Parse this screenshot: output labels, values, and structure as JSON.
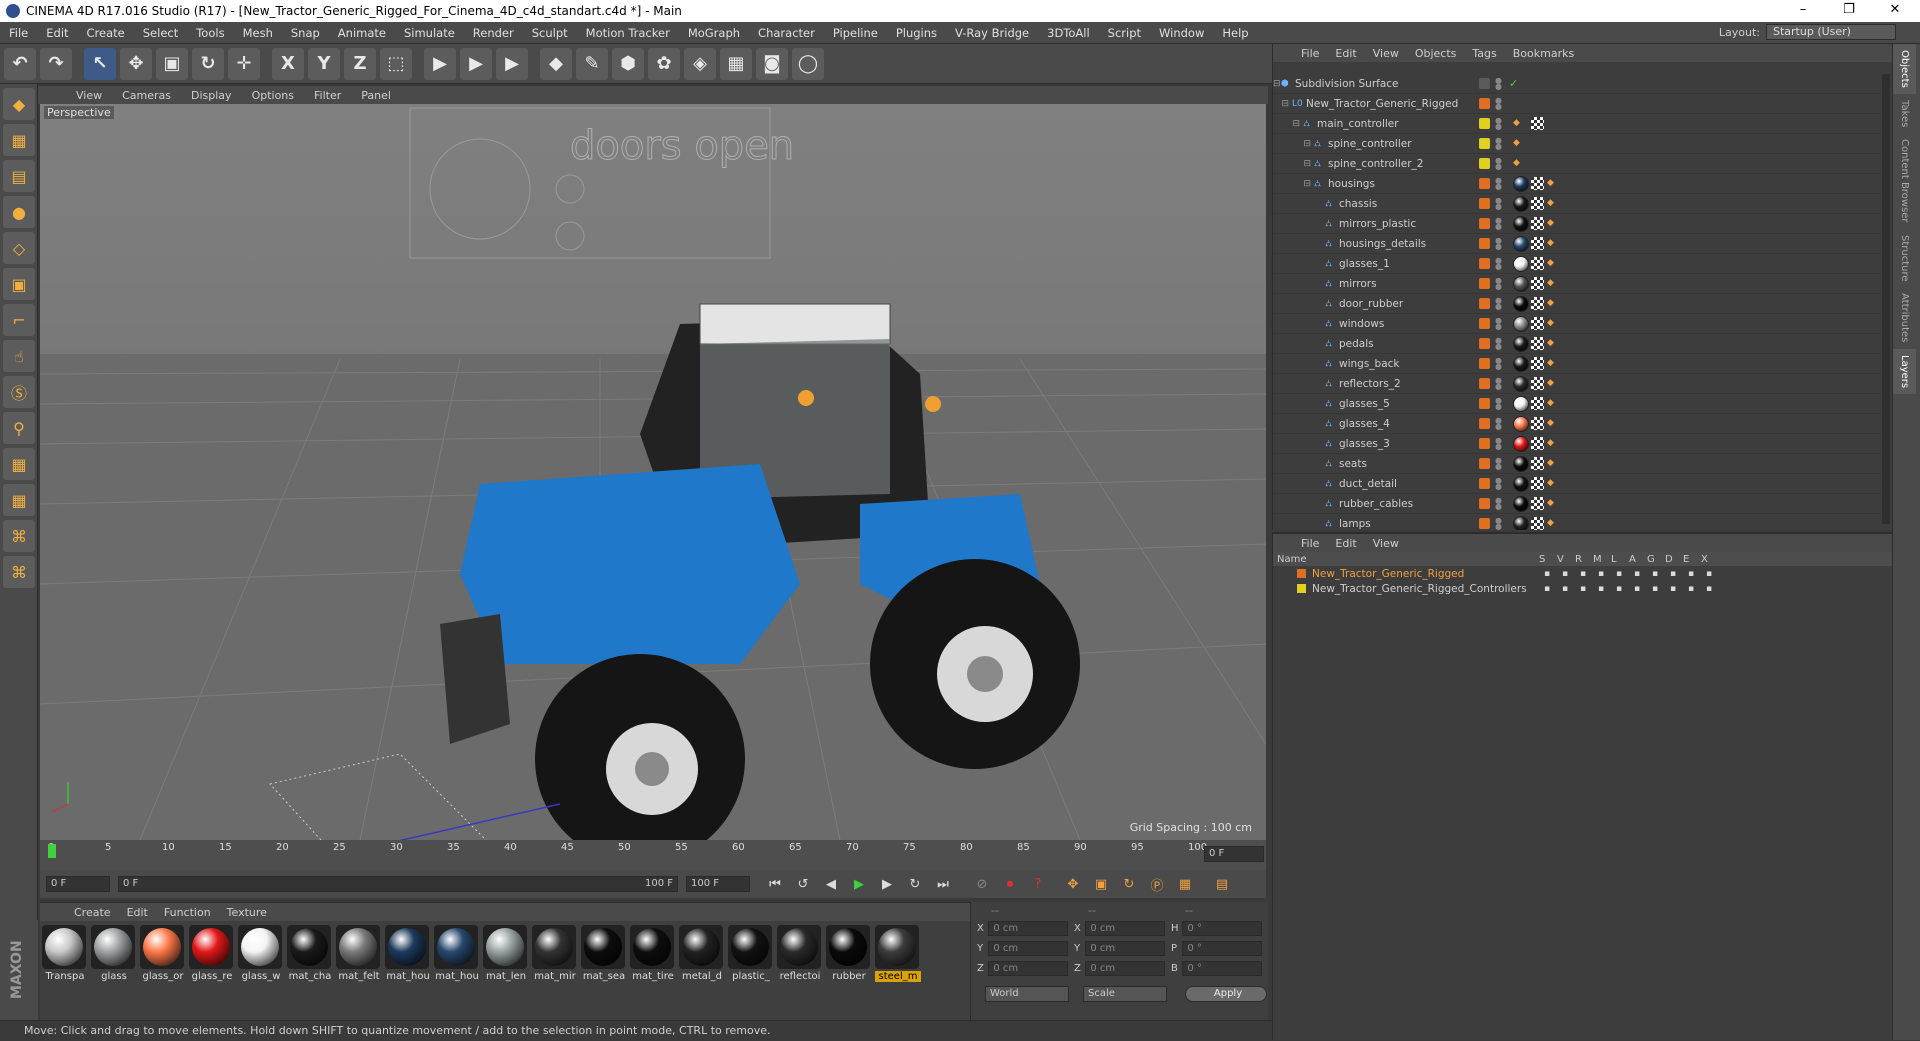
{
  "window": {
    "title": "CINEMA 4D R17.016 Studio (R17) - [New_Tractor_Generic_Rigged_For_Cinema_4D_c4d_standart.c4d *] - Main",
    "minimize": "–",
    "maximize": "❐",
    "close": "✕"
  },
  "menu": [
    "File",
    "Edit",
    "Create",
    "Select",
    "Tools",
    "Mesh",
    "Snap",
    "Animate",
    "Simulate",
    "Render",
    "Sculpt",
    "Motion Tracker",
    "MoGraph",
    "Character",
    "Pipeline",
    "Plugins",
    "V-Ray Bridge",
    "3DToAll",
    "Script",
    "Window",
    "Help"
  ],
  "layout": {
    "label": "Layout:",
    "value": "Startup (User)"
  },
  "toolbar": [
    {
      "name": "undo-button",
      "glyph": "↶"
    },
    {
      "name": "redo-button",
      "glyph": "↷"
    },
    {
      "name": "select-tool-button",
      "glyph": "↖",
      "active": true
    },
    {
      "name": "move-tool-button",
      "glyph": "✥"
    },
    {
      "name": "scale-tool-button",
      "glyph": "▣"
    },
    {
      "name": "rotate-tool-button",
      "glyph": "↻"
    },
    {
      "name": "create-tool-button",
      "glyph": "✛"
    },
    {
      "name": "x-axis-button",
      "glyph": "X"
    },
    {
      "name": "y-axis-button",
      "glyph": "Y"
    },
    {
      "name": "z-axis-button",
      "glyph": "Z"
    },
    {
      "name": "coordinate-system-button",
      "glyph": "⬚"
    },
    {
      "name": "render-view-button",
      "glyph": "▶"
    },
    {
      "name": "render-picture-viewer-button",
      "glyph": "▶"
    },
    {
      "name": "render-settings-button",
      "glyph": "▶"
    },
    {
      "name": "cube-object-button",
      "glyph": "◆"
    },
    {
      "name": "spline-pen-button",
      "glyph": "✎"
    },
    {
      "name": "subdivision-surface-button",
      "glyph": "⬢"
    },
    {
      "name": "mograph-cloner-button",
      "glyph": "✿"
    },
    {
      "name": "deformer-button",
      "glyph": "◈"
    },
    {
      "name": "floor-object-button",
      "glyph": "▦"
    },
    {
      "name": "camera-object-button",
      "glyph": "◙"
    },
    {
      "name": "light-object-button",
      "glyph": "◯"
    }
  ],
  "left_tools": [
    "cube-mode-icon",
    "texture-mode-icon",
    "workplane-icon",
    "points-mode-icon",
    "edges-mode-icon",
    "polygons-mode-icon",
    "axis-icon",
    "tweak-icon",
    "snap-icon",
    "magnet-icon",
    "grid-lock-icon",
    "sculpt-icon",
    "python-icon",
    "python-2-icon"
  ],
  "viewport": {
    "menu": [
      "View",
      "Cameras",
      "Display",
      "Options",
      "Filter",
      "Panel"
    ],
    "camera": "Perspective",
    "grid_spacing": "Grid Spacing : 100 cm",
    "sign_text": "doors open"
  },
  "timeline": {
    "ticks": [
      "0",
      "5",
      "10",
      "15",
      "20",
      "25",
      "30",
      "35",
      "40",
      "45",
      "50",
      "55",
      "60",
      "65",
      "70",
      "75",
      "80",
      "85",
      "90",
      "95",
      "100"
    ],
    "current": "0 F"
  },
  "playbar": {
    "start": "0 F",
    "range_start": "0 F",
    "range_end": "100 F",
    "end": "100 F"
  },
  "materials": {
    "menu": [
      "Create",
      "Edit",
      "Function",
      "Texture"
    ],
    "items": [
      {
        "label": "Transpa",
        "color": "#c9c9c9"
      },
      {
        "label": "glass",
        "color": "#9fa3a3"
      },
      {
        "label": "glass_or",
        "color": "#ff7a4a"
      },
      {
        "label": "glass_re",
        "color": "#e21818"
      },
      {
        "label": "glass_w",
        "color": "#f4f4f4"
      },
      {
        "label": "mat_cha",
        "color": "#1a1a1a"
      },
      {
        "label": "mat_felt",
        "color": "#7a7a7a"
      },
      {
        "label": "mat_hou",
        "color": "#1d3a5c"
      },
      {
        "label": "mat_hou",
        "color": "#27486d"
      },
      {
        "label": "mat_len",
        "color": "#9aa2a2"
      },
      {
        "label": "mat_mir",
        "color": "#333"
      },
      {
        "label": "mat_sea",
        "color": "#0c0c0c"
      },
      {
        "label": "mat_tire",
        "color": "#0e0e0e"
      },
      {
        "label": "metal_d",
        "color": "#222"
      },
      {
        "label": "plastic_",
        "color": "#121212"
      },
      {
        "label": "reflectoi",
        "color": "#2a2a2a"
      },
      {
        "label": "rubber",
        "color": "#0a0a0a"
      },
      {
        "label": "steel_m",
        "color": "#3c3c3c",
        "selected": true
      }
    ]
  },
  "coords": {
    "headers": [
      "--",
      "--",
      "--"
    ],
    "rows": [
      [
        "X",
        "0 cm",
        "X",
        "0 cm",
        "H",
        "0 °"
      ],
      [
        "Y",
        "0 cm",
        "Y",
        "0 cm",
        "P",
        "0 °"
      ],
      [
        "Z",
        "0 cm",
        "Z",
        "0 cm",
        "B",
        "0 °"
      ]
    ],
    "world": "World",
    "scale": "Scale",
    "apply": "Apply"
  },
  "objects": {
    "menu": [
      "File",
      "Edit",
      "View",
      "Objects",
      "Tags",
      "Bookmarks"
    ],
    "rows": [
      {
        "name": "Subdivision Surface",
        "indent": 0,
        "tag": "#5a5a5a",
        "icon": "⬢",
        "mat": ""
      },
      {
        "name": "New_Tractor_Generic_Rigged",
        "indent": 1,
        "tag": "#e07020",
        "icon": "L0",
        "mat": ""
      },
      {
        "name": "main_controller",
        "indent": 2,
        "tag": "#e0d020",
        "icon": "⛼",
        "mat": ""
      },
      {
        "name": "spine_controller",
        "indent": 3,
        "tag": "#e0d020",
        "icon": "⛼",
        "mat": ""
      },
      {
        "name": "spine_controller_2",
        "indent": 3,
        "tag": "#e0d020",
        "icon": "⛼",
        "mat": ""
      },
      {
        "name": "housings",
        "indent": 3,
        "tag": "#e07020",
        "icon": "⛼",
        "mat": "#1d3a5c"
      },
      {
        "name": "chassis",
        "indent": 4,
        "tag": "#e07020",
        "icon": "⛼",
        "mat": "#1a1a1a"
      },
      {
        "name": "mirrors_plastic",
        "indent": 4,
        "tag": "#e07020",
        "icon": "⛼",
        "mat": "#111"
      },
      {
        "name": "housings_details",
        "indent": 4,
        "tag": "#e07020",
        "icon": "⛼",
        "mat": "#27486d"
      },
      {
        "name": "glasses_1",
        "indent": 4,
        "tag": "#e07020",
        "icon": "⛼",
        "mat": "#f4f4f4"
      },
      {
        "name": "mirrors",
        "indent": 4,
        "tag": "#e07020",
        "icon": "⛼",
        "mat": "#555"
      },
      {
        "name": "door_rubber",
        "indent": 4,
        "tag": "#e07020",
        "icon": "⛼",
        "mat": "#0a0a0a"
      },
      {
        "name": "windows",
        "indent": 4,
        "tag": "#e07020",
        "icon": "⛼",
        "mat": "#8a9090"
      },
      {
        "name": "pedals",
        "indent": 4,
        "tag": "#e07020",
        "icon": "⛼",
        "mat": "#1a1a1a"
      },
      {
        "name": "wings_back",
        "indent": 4,
        "tag": "#e07020",
        "icon": "⛼",
        "mat": "#1a1a1a"
      },
      {
        "name": "reflectors_2",
        "indent": 4,
        "tag": "#e07020",
        "icon": "⛼",
        "mat": "#2a2a2a"
      },
      {
        "name": "glasses_5",
        "indent": 4,
        "tag": "#e07020",
        "icon": "⛼",
        "mat": "#f4f4f4"
      },
      {
        "name": "glasses_4",
        "indent": 4,
        "tag": "#e07020",
        "icon": "⛼",
        "mat": "#ff7a4a"
      },
      {
        "name": "glasses_3",
        "indent": 4,
        "tag": "#e07020",
        "icon": "⛼",
        "mat": "#e21818"
      },
      {
        "name": "seats",
        "indent": 4,
        "tag": "#e07020",
        "icon": "⛼",
        "mat": "#0c0c0c"
      },
      {
        "name": "duct_detail",
        "indent": 4,
        "tag": "#e07020",
        "icon": "⛼",
        "mat": "#121212"
      },
      {
        "name": "rubber_cables",
        "indent": 4,
        "tag": "#e07020",
        "icon": "⛼",
        "mat": "#0a0a0a"
      },
      {
        "name": "lamps",
        "indent": 4,
        "tag": "#e07020",
        "icon": "⛼",
        "mat": "#222"
      }
    ]
  },
  "layers": {
    "menu": [
      "File",
      "Edit",
      "View"
    ],
    "headers": [
      "Name",
      "S",
      "V",
      "R",
      "M",
      "L",
      "A",
      "G",
      "D",
      "E",
      "X"
    ],
    "rows": [
      {
        "name": "New_Tractor_Generic_Rigged",
        "color": "#e07020",
        "text": "#f0a040"
      },
      {
        "name": "New_Tractor_Generic_Rigged_Controllers",
        "color": "#e0d020",
        "text": "#cfcfcf"
      }
    ]
  },
  "right_tabs": [
    "Objects",
    "Takes",
    "Content Browser",
    "Structure",
    "Attributes",
    "Layers"
  ],
  "status": "Move: Click and drag to move elements. Hold down SHIFT to quantize movement / add to the selection in point mode, CTRL to remove."
}
